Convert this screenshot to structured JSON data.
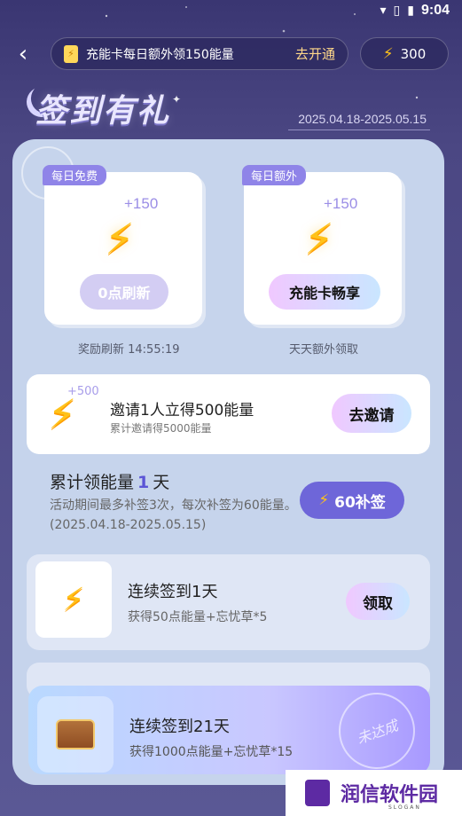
{
  "status_bar": {
    "time": "9:04"
  },
  "header": {
    "back_icon": "chevron-left-icon",
    "promo_text": "充能卡每日额外领150能量",
    "promo_action": "去开通",
    "energy_balance": "300"
  },
  "title": {
    "text": "签到有礼",
    "date_range": "2025.04.18-2025.05.15"
  },
  "rewards": [
    {
      "tag": "每日免费",
      "amount": "+150",
      "button": "0点刷新",
      "caption": "奖励刷新 14:55:19"
    },
    {
      "tag": "每日额外",
      "amount": "+150",
      "button": "充能卡畅享",
      "caption": "天天额外领取"
    }
  ],
  "invite": {
    "badge": "+500",
    "title": "邀请1人立得500能量",
    "subtitle": "累计邀请得5000能量",
    "button": "去邀请"
  },
  "cumulative": {
    "prefix": "累计领能量",
    "count": "1",
    "suffix": "天",
    "description": "活动期间最多补签3次，每次补签为60能量。(2025.04.18-2025.05.15)",
    "makeup_button": "60补签"
  },
  "tasks": [
    {
      "title": "连续签到1天",
      "subtitle": "获得50点能量+忘忧草*5",
      "button": "领取"
    }
  ],
  "final_task": {
    "title": "连续签到21天",
    "subtitle": "获得1000点能量+忘忧草*15",
    "stamp": "未达成"
  },
  "watermark": {
    "text": "润信软件园",
    "slogan": "SLOGAN"
  }
}
